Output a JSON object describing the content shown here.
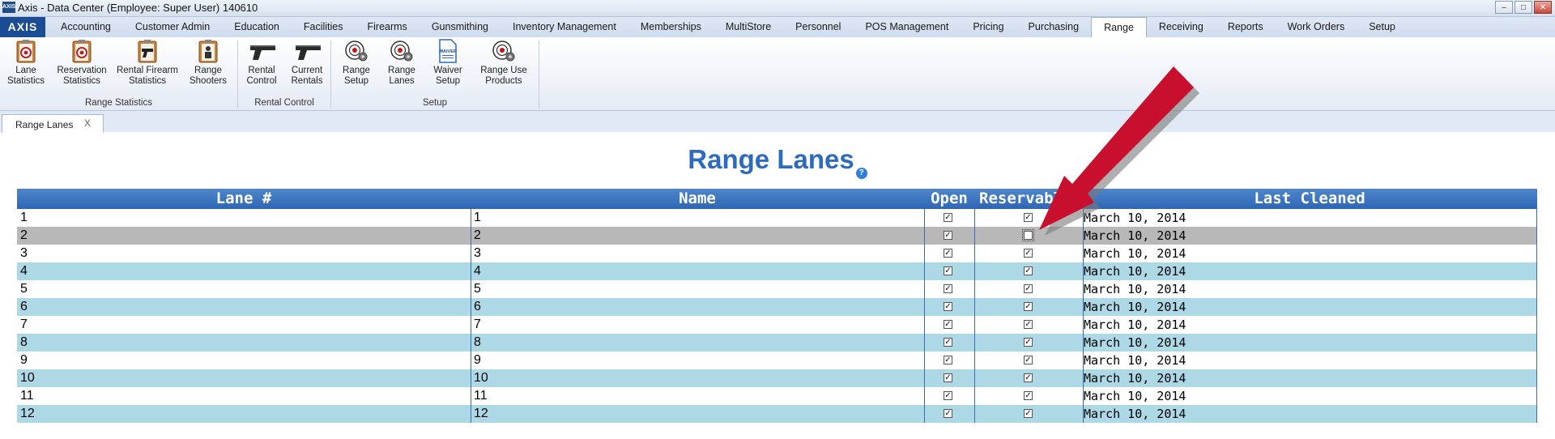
{
  "window": {
    "title": "Axis - Data Center  (Employee: Super User) 140610",
    "app_icon": "AXIS"
  },
  "menu": {
    "logo": "AXIS",
    "tabs": [
      {
        "label": "Accounting"
      },
      {
        "label": "Customer Admin"
      },
      {
        "label": "Education"
      },
      {
        "label": "Facilities"
      },
      {
        "label": "Firearms"
      },
      {
        "label": "Gunsmithing"
      },
      {
        "label": "Inventory Management"
      },
      {
        "label": "Memberships"
      },
      {
        "label": "MultiStore"
      },
      {
        "label": "Personnel"
      },
      {
        "label": "POS Management"
      },
      {
        "label": "Pricing"
      },
      {
        "label": "Purchasing"
      },
      {
        "label": "Range"
      },
      {
        "label": "Receiving"
      },
      {
        "label": "Reports"
      },
      {
        "label": "Work Orders"
      },
      {
        "label": "Setup"
      }
    ],
    "active_tab": "Range"
  },
  "ribbon": {
    "groups": [
      {
        "label": "Range Statistics",
        "buttons": [
          {
            "l1": "Lane",
            "l2": "Statistics",
            "icon": "clipboard-target-icon"
          },
          {
            "l1": "Reservation",
            "l2": "Statistics",
            "icon": "clipboard-target-icon"
          },
          {
            "l1": "Rental Firearm",
            "l2": "Statistics",
            "icon": "clipboard-pistol-icon"
          },
          {
            "l1": "Range",
            "l2": "Shooters",
            "icon": "clipboard-shooter-icon"
          }
        ]
      },
      {
        "label": "Rental Control",
        "buttons": [
          {
            "l1": "Rental",
            "l2": "Control",
            "icon": "pistol-icon"
          },
          {
            "l1": "Current",
            "l2": "Rentals",
            "icon": "pistol-icon"
          }
        ]
      },
      {
        "label": "Setup",
        "buttons": [
          {
            "l1": "Range",
            "l2": "Setup",
            "icon": "target-gear-icon"
          },
          {
            "l1": "Range",
            "l2": "Lanes",
            "icon": "target-gear-icon"
          },
          {
            "l1": "Waiver",
            "l2": "Setup",
            "icon": "waiver-document-icon",
            "icon_text": "WAIVER"
          },
          {
            "l1": "Range Use",
            "l2": "Products",
            "icon": "target-gear-icon"
          }
        ]
      }
    ]
  },
  "doc_tab": {
    "label": "Range Lanes",
    "close": "X"
  },
  "page": {
    "title": "Range Lanes",
    "help": "?"
  },
  "table": {
    "columns": [
      "Lane #",
      "Name",
      "Open",
      "Reservable",
      "Last Cleaned"
    ],
    "selected_row": 1,
    "rows": [
      {
        "lane": "1",
        "name": "1",
        "open": true,
        "reservable": true,
        "last_cleaned": "March 10, 2014"
      },
      {
        "lane": "2",
        "name": "2",
        "open": true,
        "reservable": false,
        "last_cleaned": "March 10, 2014"
      },
      {
        "lane": "3",
        "name": "3",
        "open": true,
        "reservable": true,
        "last_cleaned": "March 10, 2014"
      },
      {
        "lane": "4",
        "name": "4",
        "open": true,
        "reservable": true,
        "last_cleaned": "March 10, 2014"
      },
      {
        "lane": "5",
        "name": "5",
        "open": true,
        "reservable": true,
        "last_cleaned": "March 10, 2014"
      },
      {
        "lane": "6",
        "name": "6",
        "open": true,
        "reservable": true,
        "last_cleaned": "March 10, 2014"
      },
      {
        "lane": "7",
        "name": "7",
        "open": true,
        "reservable": true,
        "last_cleaned": "March 10, 2014"
      },
      {
        "lane": "8",
        "name": "8",
        "open": true,
        "reservable": true,
        "last_cleaned": "March 10, 2014"
      },
      {
        "lane": "9",
        "name": "9",
        "open": true,
        "reservable": true,
        "last_cleaned": "March 10, 2014"
      },
      {
        "lane": "10",
        "name": "10",
        "open": true,
        "reservable": true,
        "last_cleaned": "March 10, 2014"
      },
      {
        "lane": "11",
        "name": "11",
        "open": true,
        "reservable": true,
        "last_cleaned": "March 10, 2014"
      },
      {
        "lane": "12",
        "name": "12",
        "open": true,
        "reservable": true,
        "last_cleaned": "March 10, 2014"
      }
    ]
  },
  "colors": {
    "accent": "#2d6bbf",
    "header": "#3a72bf",
    "row_alt": "#add8e6",
    "row_selected": "#b8b8b8",
    "arrow": "#c8102e"
  }
}
